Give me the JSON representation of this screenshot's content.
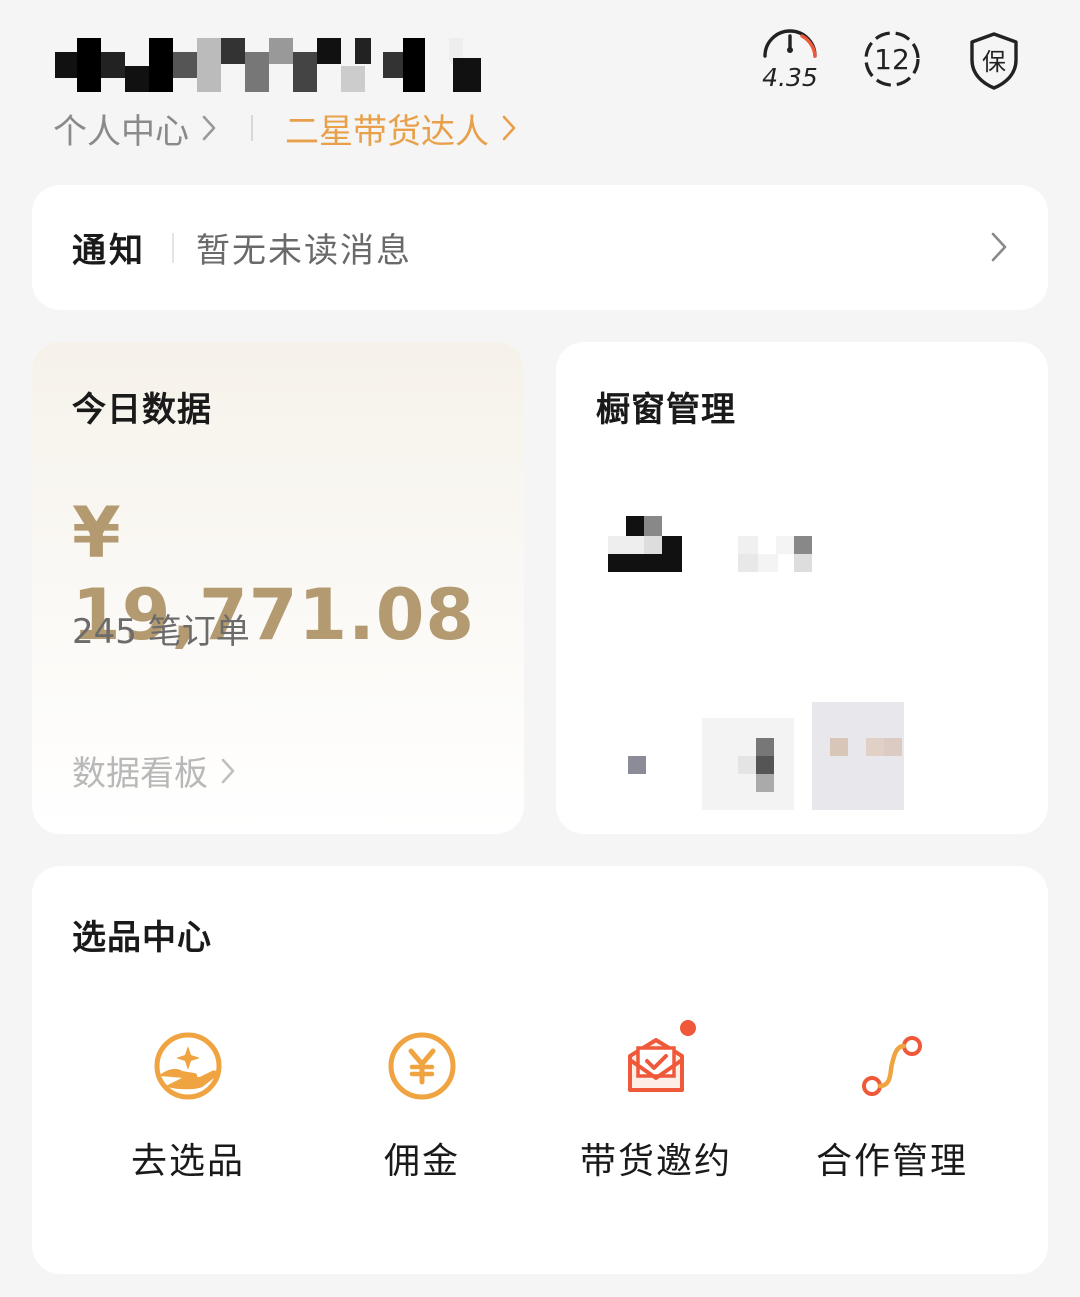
{
  "header": {
    "personal_center": "个人中心",
    "level_label": "二星带货达人",
    "score_value": "4.35",
    "badge_count": "12",
    "guarantee_label": "保"
  },
  "notice": {
    "title": "通知",
    "text": "暂无未读消息"
  },
  "today": {
    "title": "今日数据",
    "amount": "¥ 19,771.08",
    "orders": "245 笔订单",
    "board_link": "数据看板"
  },
  "window": {
    "title": "橱窗管理"
  },
  "selection": {
    "title": "选品中心",
    "actions": [
      {
        "label": "去选品",
        "icon": "hand-star-icon"
      },
      {
        "label": "佣金",
        "icon": "yen-coin-icon"
      },
      {
        "label": "带货邀约",
        "icon": "invite-envelope-icon"
      },
      {
        "label": "合作管理",
        "icon": "collaboration-path-icon"
      }
    ]
  },
  "colors": {
    "accent": "#e9a04a",
    "amount": "#b49a70",
    "icon_orange": "#f0a441",
    "icon_red": "#f0583a"
  }
}
